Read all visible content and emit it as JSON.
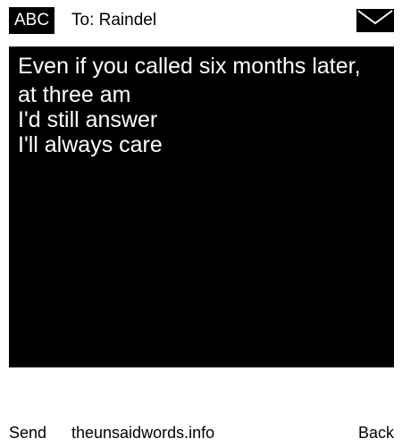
{
  "header": {
    "input_mode": "ABC",
    "recipient": "To: Raindel",
    "icon": "envelope-icon"
  },
  "message": {
    "lines": [
      "Even if you called six months later,",
      "at three am",
      "I'd still answer",
      "I'll always care"
    ]
  },
  "softkeys": {
    "left": "Send",
    "center": "theunsaidwords.info",
    "right": "Back"
  },
  "colors": {
    "background": "#ffffff",
    "message_background": "#000000",
    "message_text": "#ffffff"
  }
}
